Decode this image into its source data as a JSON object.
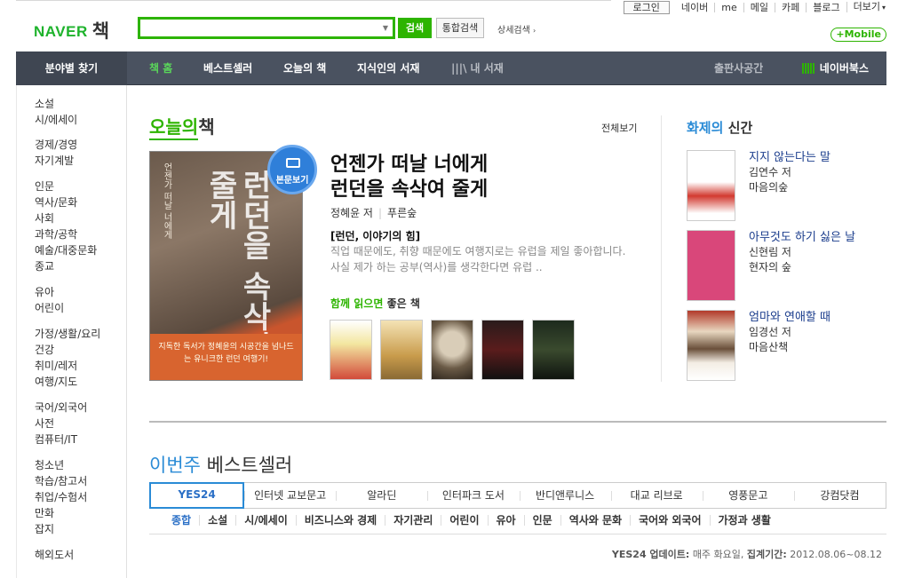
{
  "util": {
    "login": "로그인",
    "links": [
      "네이버",
      "me",
      "메일",
      "카페",
      "블로그",
      "더보기"
    ]
  },
  "header": {
    "logo": "NAVER",
    "logo_service": "책",
    "search_value": "",
    "search_button": "검색",
    "all_search_button": "통합검색",
    "advanced_search": "상세검색",
    "mobile": "+Mobile"
  },
  "nav": {
    "category": "분야별 찾기",
    "items": [
      "책 홈",
      "베스트셀러",
      "오늘의 책",
      "지식인의 서재",
      "내 서재"
    ],
    "publisher": "출판사공간",
    "naverbooks": "네이버북스"
  },
  "sidebar": {
    "groups": [
      [
        "소설",
        "시/에세이"
      ],
      [
        "경제/경영",
        "자기계발"
      ],
      [
        "인문",
        "역사/문화",
        "사회",
        "과학/공학",
        "예술/대중문화",
        "종교"
      ],
      [
        "유아",
        "어린이"
      ],
      [
        "가정/생활/요리",
        "건강",
        "취미/레저",
        "여행/지도"
      ],
      [
        "국어/외국어",
        "사전",
        "컴퓨터/IT"
      ],
      [
        "청소년",
        "학습/참고서",
        "취업/수험서",
        "만화",
        "잡지"
      ],
      [
        "해외도서"
      ]
    ]
  },
  "today": {
    "title_a": "오늘의",
    "title_b": "책",
    "view_all": "전체보기",
    "badge": "본문보기",
    "book_title_1": "언젠가 떠날 너에게",
    "book_title_2": "런던을 속삭여 줄게",
    "author": "정혜윤 저",
    "publisher": "푸른숲",
    "subtitle": "[런던, 이야기의 힘]",
    "desc": "직업 때문에도, 취향 때문에도 여행지로는 유럽을 제일 좋아합니다. 사실 제가 하는 공부(역사)를 생각한다면 유럽 ..",
    "read_with_a": "함께 읽으면",
    "read_with_b": "좋은 책",
    "cover_top": "언젠가 떠날 너에게",
    "cover_big": "런던을 속삭여 줄게",
    "cover_band": "지독한 독서가 정혜윤의 시공간을 넘나드는 유니크한 런던 여행기!"
  },
  "hot": {
    "title_a": "화제의",
    "title_b": "신간",
    "items": [
      {
        "title": "지지 않는다는 말",
        "author": "김연수 저",
        "publisher": "마음의숲"
      },
      {
        "title": "아무것도 하기 싫은 날",
        "author": "신현림 저",
        "publisher": "현자의 숲"
      },
      {
        "title": "엄마와 연애할 때",
        "author": "임경선 저",
        "publisher": "마음산책"
      }
    ]
  },
  "bestseller": {
    "title_a": "이번주",
    "title_b": "베스트셀러",
    "tabs": [
      "YES24",
      "인터넷 교보문고",
      "알라딘",
      "인터파크 도서",
      "반디앤루니스",
      "대교 리브로",
      "영풍문고",
      "강컴닷컴"
    ],
    "cats": [
      "종합",
      "소설",
      "시/에세이",
      "비즈니스와 경제",
      "자기관리",
      "어린이",
      "유아",
      "인문",
      "역사와 문화",
      "국어와 외국어",
      "가정과 생활"
    ],
    "update_label": "YES24 업데이트:",
    "update_value": "매주 화요일,",
    "period_label": "집계기간:",
    "period_value": "2012.08.06~08.12"
  },
  "colors": {
    "accent_green": "#2db400",
    "nav_bg": "#4a5260",
    "link_blue": "#2a8bd6"
  }
}
